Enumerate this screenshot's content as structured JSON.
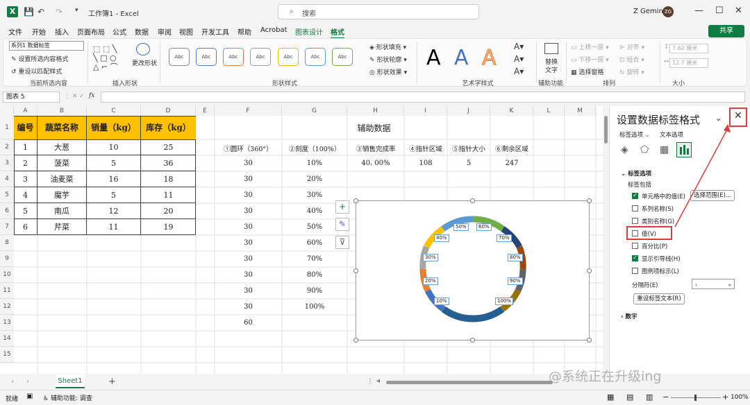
{
  "app": {
    "title": "工作簿1 - Excel",
    "search_placeholder": "搜索",
    "user": "Z Gemini",
    "avatar": "ZG"
  },
  "menu": [
    "文件",
    "开始",
    "插入",
    "页面布局",
    "公式",
    "数据",
    "审阅",
    "视图",
    "开发工具",
    "帮助",
    "Acrobat",
    "图表设计",
    "格式"
  ],
  "share": "共享",
  "ribbon": {
    "selection_combo": "系列1 数据标签",
    "format_selection": "设置所选内容格式",
    "reset_style": "重设以匹配样式",
    "group_current": "当前所选内容",
    "change_shape": "更改形状",
    "group_insert_shapes": "插入形状",
    "shape_style_abc": "Abc",
    "shape_fill": "形状填充",
    "shape_outline": "形状轮廓",
    "shape_effects": "形状效果",
    "group_shape_styles": "形状样式",
    "art_A": "A",
    "group_wordart": "艺术字样式",
    "alt_text_1": "替换",
    "alt_text_2": "文字",
    "group_accessibility": "辅助功能",
    "bring_forward": "上移一层",
    "send_backward": "下移一层",
    "selection_pane": "选择窗格",
    "align": "对齐",
    "group_obj": "组合",
    "rotate": "旋转",
    "group_arrange": "排列",
    "height": "7.62 厘米",
    "width": "12.7 厘米",
    "group_size": "大小"
  },
  "namebox": "图表 5",
  "fx": "fx",
  "columns": [
    "A",
    "B",
    "C",
    "D",
    "E",
    "F",
    "G",
    "H",
    "I",
    "J",
    "K",
    "L",
    "M"
  ],
  "rows": [
    "1",
    "2",
    "3",
    "4",
    "5",
    "6",
    "7",
    "8",
    "9",
    "10",
    "11",
    "12",
    "13",
    "14",
    "15"
  ],
  "table": {
    "headers": [
      "编号",
      "蔬菜名称",
      "销量（kg）",
      "库存（kg）"
    ],
    "rows": [
      [
        "1",
        "大葱",
        "10",
        "25"
      ],
      [
        "2",
        "菠菜",
        "5",
        "36"
      ],
      [
        "3",
        "油麦菜",
        "16",
        "18"
      ],
      [
        "4",
        "魔芋",
        "5",
        "11"
      ],
      [
        "5",
        "南瓜",
        "12",
        "20"
      ],
      [
        "6",
        "芹菜",
        "11",
        "19"
      ]
    ]
  },
  "aux": {
    "title": "辅助数据",
    "headers": [
      "①圆环（360°）",
      "②刻度（100%）",
      "③销售完成率",
      "④指针区域",
      "⑤指针大小",
      "⑥剩余区域"
    ],
    "row3": [
      "30",
      "10%",
      "40. 00%",
      "108",
      "5",
      "247"
    ],
    "f_col": [
      "30",
      "30",
      "30",
      "30",
      "30",
      "30",
      "30",
      "30",
      "30",
      "60"
    ],
    "g_col": [
      "20%",
      "30%",
      "40%",
      "50%",
      "60%",
      "70%",
      "80%",
      "90%",
      "100%"
    ]
  },
  "chart_labels": [
    "50%",
    "60%",
    "40%",
    "70%",
    "30%",
    "80%",
    "20%",
    "90%",
    "10%",
    "100%"
  ],
  "panel": {
    "title": "设置数据标签格式",
    "tab_label_options": "标签选项",
    "tab_text_options": "文本选项",
    "section": "标签选项",
    "contains": "标签包括",
    "opt_cell_value": "单元格中的值(E)",
    "select_range": "选择范围(E)...",
    "opt_series": "系列名称(S)",
    "opt_category": "类别名称(G)",
    "opt_value": "值(V)",
    "opt_percent": "百分比(P)",
    "opt_leader": "显示引导线(H)",
    "opt_legend_key": "图例项标示(L)",
    "separator_label": "分隔符(E)",
    "separator_value": ",",
    "reset_text": "重设标签文本(R)",
    "number_section": "数字"
  },
  "sheet_tab": "Sheet1",
  "status": {
    "ready": "就绪",
    "accessibility": "辅助功能: 调查",
    "zoom": "100%"
  },
  "watermark": "@系统正在升级ing",
  "colors": {
    "excel_green": "#107c41",
    "header_fill": "#ffc000",
    "highlight_red": "#e03a3a"
  }
}
